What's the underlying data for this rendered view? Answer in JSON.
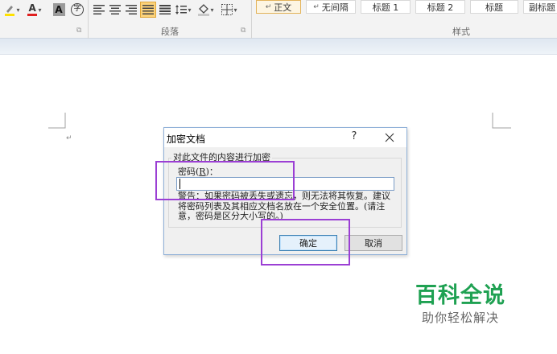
{
  "ribbon": {
    "paragraph_group_label": "段落",
    "styles_group_label": "样式",
    "styles": [
      "正文",
      "无间隔",
      "标题 1",
      "标题 2",
      "标题",
      "副标题"
    ],
    "font_color_letter": "A",
    "char_shading_letter": "A",
    "enclose_char": "字"
  },
  "dialog": {
    "title": "加密文档",
    "help": "?",
    "group_label": "对此文件的内容进行加密",
    "password_label_pre": "密码(",
    "password_label_key": "R",
    "password_label_post": ")：",
    "password_value": "",
    "warning": "警告：如果密码被丢失或遗忘，则无法将其恢复。建议将密码列表及其相应文档名放在一个安全位置。(请注意，密码是区分大小写的。)",
    "ok_label": "确定",
    "cancel_label": "取消"
  },
  "watermark": {
    "title": "百科全说",
    "subtitle": "助你轻松解决"
  },
  "colors": {
    "highlight": "#9b3fd4",
    "watermark_green": "#1fa152",
    "active_style_border": "#e3b35a",
    "font_color_red": "#e02020",
    "highlight_yellow": "#ffe100"
  }
}
